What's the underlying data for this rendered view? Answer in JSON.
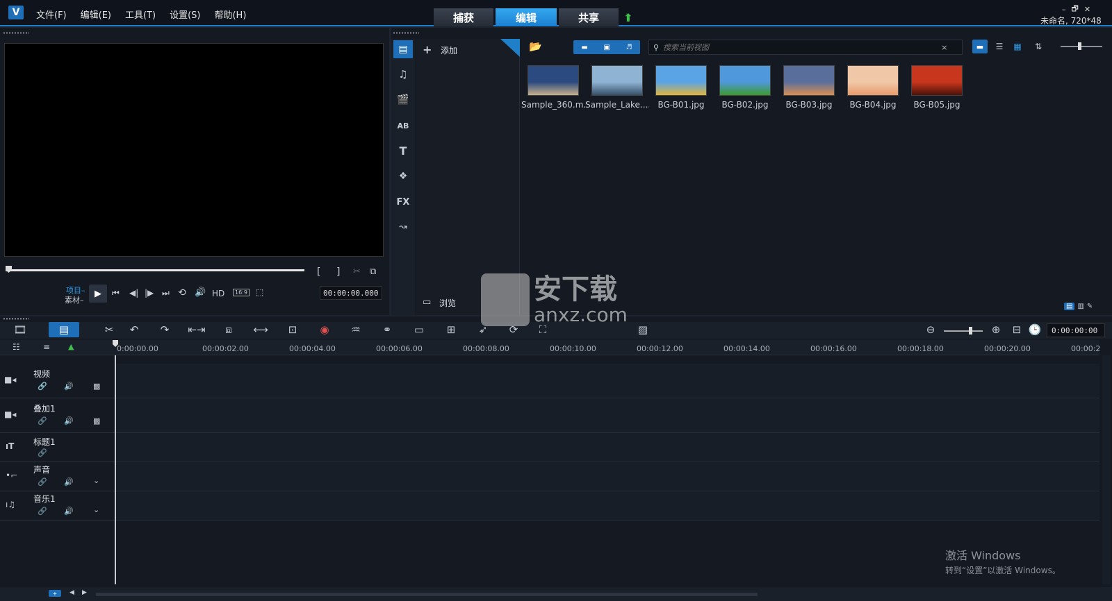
{
  "app": {
    "logo": "V",
    "title": "未命名, 720*48",
    "window_controls": [
      "–",
      "🗗",
      "✕"
    ]
  },
  "menu": [
    {
      "label": "文件(F)"
    },
    {
      "label": "编辑(E)"
    },
    {
      "label": "工具(T)"
    },
    {
      "label": "设置(S)"
    },
    {
      "label": "帮助(H)"
    }
  ],
  "modes": [
    {
      "label": "捕获"
    },
    {
      "label": "编辑"
    },
    {
      "label": "共享"
    }
  ],
  "player": {
    "project_label": "项目–",
    "clip_label": "素材–",
    "hd": "HD",
    "aspect": "16:9",
    "timecode": "00:00:00.000",
    "mark_in": "[",
    "mark_out": "]"
  },
  "library": {
    "add_label": "添加",
    "browse_label": "浏览",
    "search_placeholder": "搜索当前视图",
    "search_clear": "×",
    "thumbnails": [
      {
        "label": "Sample_360.m...",
        "type": "video",
        "colors": [
          "#2b4a80",
          "#c7b08a"
        ]
      },
      {
        "label": "Sample_Lake....",
        "type": "video",
        "colors": [
          "#8fb3d3",
          "#36506a"
        ]
      },
      {
        "label": "BG-B01.jpg",
        "type": "image",
        "colors": [
          "#5aa4e6",
          "#e0b43a"
        ]
      },
      {
        "label": "BG-B02.jpg",
        "type": "image",
        "colors": [
          "#4f98dc",
          "#3c9a2e"
        ]
      },
      {
        "label": "BG-B03.jpg",
        "type": "image",
        "colors": [
          "#5a6e9c",
          "#d98f52"
        ]
      },
      {
        "label": "BG-B04.jpg",
        "type": "image",
        "colors": [
          "#f0c8a8",
          "#e89a6a"
        ]
      },
      {
        "label": "BG-B05.jpg",
        "type": "image",
        "colors": [
          "#c8361e",
          "#4a1208"
        ]
      }
    ]
  },
  "timeline": {
    "zoom_timecode": "0:00:00:00",
    "ruler": [
      "0:00:00.00",
      "00:00:02.00",
      "00:00:04.00",
      "00:00:06.00",
      "00:00:08.00",
      "00:00:10.00",
      "00:00:12.00",
      "00:00:14.00",
      "00:00:16.00",
      "00:00:18.00",
      "00:00:20.00",
      "00:00:2"
    ],
    "tracks": [
      {
        "name": "视频",
        "icon": "video-camera-icon"
      },
      {
        "name": "叠加1",
        "icon": "overlay-camera-icon"
      },
      {
        "name": "标题1",
        "icon": "title-t-icon"
      },
      {
        "name": "声音",
        "icon": "voice-icon"
      },
      {
        "name": "音乐1",
        "icon": "music-icon"
      }
    ]
  },
  "watermark": {
    "brand": "安下载",
    "domain": "anxz.com"
  },
  "activation": {
    "title": "激活 Windows",
    "subtitle": "转到“设置”以激活 Windows。"
  },
  "colors": {
    "accent": "#1f7fc8",
    "active_tab": "#2b9be8",
    "panel_bg": "#151a22",
    "green_arrow": "#3cc04a"
  }
}
